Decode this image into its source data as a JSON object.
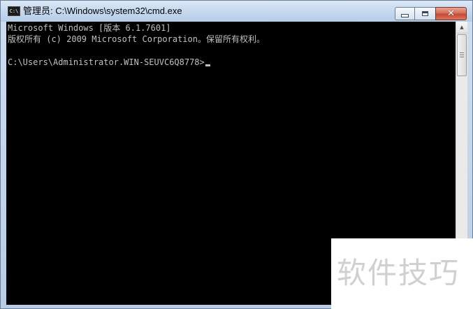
{
  "window": {
    "title": "管理员: C:\\Windows\\system32\\cmd.exe",
    "icon_label": "C:\\",
    "icon": "command-prompt-icon"
  },
  "caption_buttons": {
    "minimize": "minimize-icon",
    "maximize": "maximize-icon",
    "close_glyph": "✕"
  },
  "console": {
    "lines": [
      "Microsoft Windows [版本 6.1.7601]",
      "版权所有 (c) 2009 Microsoft Corporation。保留所有权利。",
      "",
      "C:\\Users\\Administrator.WIN-SEUVC6Q8778>"
    ],
    "text_color": "#c0c0c0",
    "background": "#000000"
  },
  "scrollbar": {
    "up_glyph": "▲"
  },
  "watermark": {
    "text": "软件技巧"
  }
}
